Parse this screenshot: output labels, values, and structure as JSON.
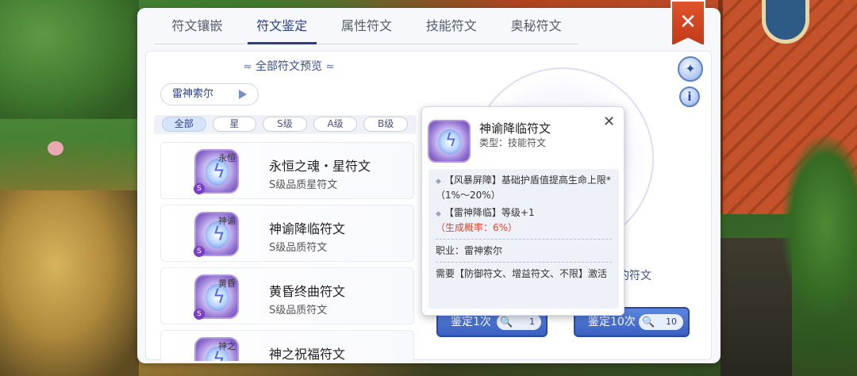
{
  "tabs": [
    {
      "label": "符文镶嵌"
    },
    {
      "label": "符文鉴定"
    },
    {
      "label": "属性符文"
    },
    {
      "label": "技能符文"
    },
    {
      "label": "奥秘符文"
    }
  ],
  "active_tab": "符文鉴定",
  "preview": {
    "title": "全部符文预览",
    "hero_select": "雷神索尔"
  },
  "filters": [
    {
      "label": "全部"
    },
    {
      "label": "星"
    },
    {
      "label": "S级"
    },
    {
      "label": "A级"
    },
    {
      "label": "B级"
    }
  ],
  "runes": [
    {
      "tag": "永恒",
      "name": "永恒之魂・星符文",
      "desc": "S级品质星符文",
      "badge": "S"
    },
    {
      "tag": "神谕",
      "name": "神谕降临符文",
      "desc": "S级品质符文",
      "badge": "S"
    },
    {
      "tag": "黄昏",
      "name": "黄昏终曲符文",
      "desc": "S级品质符文",
      "badge": "S"
    },
    {
      "tag": "神之",
      "name": "神之祝福符文",
      "desc": "",
      "badge": "S"
    }
  ],
  "tooltip": {
    "name": "神谕降临符文",
    "type": "类型：技能符文",
    "effect1": "【风暴屏障】基础护盾值提高生命上限*（1%～20%）",
    "effect2_main": "【雷神降临】等级+1",
    "effect2_red": "（生成概率：6%）",
    "job": "职业：雷神索尔",
    "requirement": "需要【防御符文、增益符文、不限】激活",
    "close": "✕"
  },
  "side": {
    "selected_label": "的符文",
    "wand_icon": "✦",
    "info_icon": "i"
  },
  "buttons": {
    "appraise_once": "鉴定1次",
    "appraise_once_cost": "1",
    "appraise_ten": "鉴定10次",
    "appraise_ten_cost": "10",
    "close": "✕"
  },
  "colors": {
    "accent": "#2a3e86",
    "close_ribbon": "#d24a23",
    "button_blue": "#3a5fc0",
    "warning_red": "#e0452c"
  }
}
